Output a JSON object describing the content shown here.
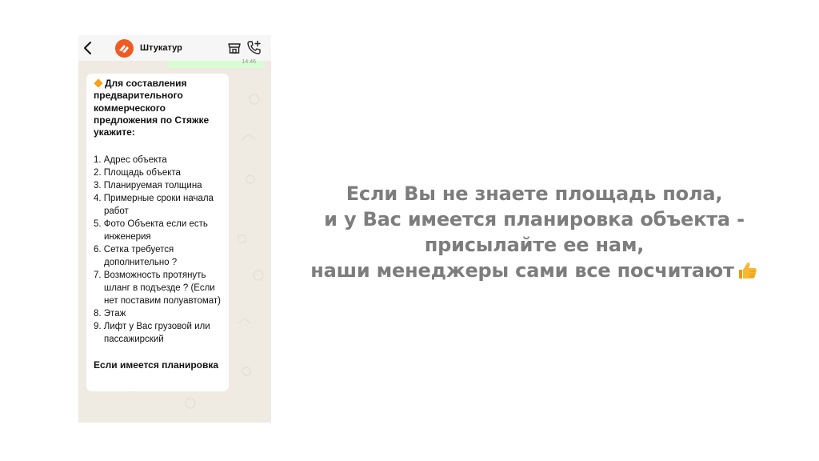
{
  "chat": {
    "contact_name": "Штукатур",
    "previous_time": "14:46",
    "message": {
      "heading": "Для составления предварительного коммерческого предложения по Стяжке укажите:",
      "items": [
        "1. Адрес объекта",
        "2. Площадь объекта",
        "3. Планируемая толщина",
        "4. Примерные сроки начала работ",
        "5. Фото Объекта если есть инженерия",
        "6. Сетка требуется дополнительно ?",
        "7. Возможность протянуть шланг в подъезде ? (Если нет поставим полуавтомат)",
        "8. Этаж",
        "9. Лифт у Вас грузовой или пассажирский"
      ],
      "footer": "Если имеется планировка"
    },
    "icons": {
      "back": "chevron-left-icon",
      "avatar": "company-logo",
      "shop": "shop-icon",
      "call": "add-call-icon",
      "plus": "plus-icon",
      "sticker": "sticker-icon",
      "camera": "camera-icon",
      "mic": "microphone-icon"
    }
  },
  "headline": {
    "lines": [
      "Если Вы не знаете площадь пола,",
      "и у Вас имеется планировка объекта -",
      "присылайте ее нам,",
      "наши менеджеры сами все посчитают"
    ],
    "emoji": "thumbs-up"
  },
  "colors": {
    "chat_background": "#efeae2",
    "bubble": "#ffffff",
    "outgoing_bubble": "#d9fdd3",
    "avatar": "#f05a24",
    "headline_text": "#7d7d7d",
    "emoji": "#f7b731"
  }
}
